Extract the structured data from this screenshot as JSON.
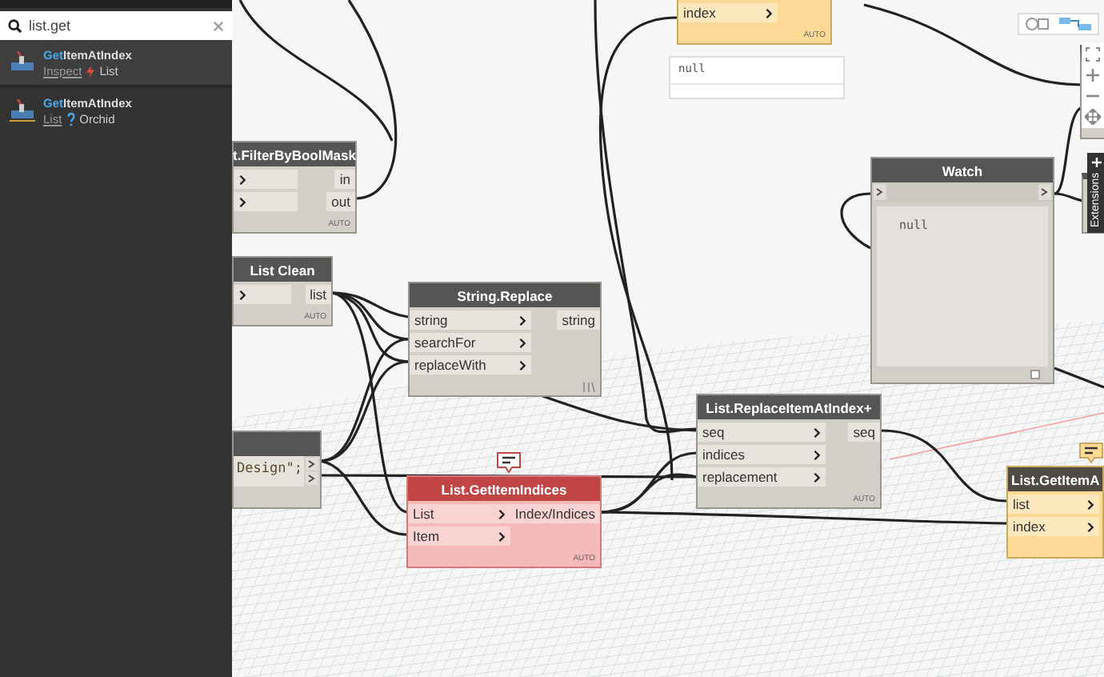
{
  "library": {
    "search": {
      "value": "list.get"
    },
    "results": [
      {
        "match": "Get",
        "rest": "ItemAtIndex",
        "category": "Inspect",
        "kind": "action",
        "package": "List",
        "selected": true
      },
      {
        "match": "Get",
        "rest": "ItemAtIndex",
        "category": "List",
        "kind": "query",
        "package": "Orchid",
        "selected": false
      }
    ]
  },
  "nodes": [
    {
      "kind": "node",
      "title": "t.FilterByBoolMask",
      "error": false,
      "warning": false,
      "inputs": [
        {
          "kind": "bare"
        },
        {
          "kind": "bare"
        }
      ],
      "outputs": [
        {
          "label": "in"
        },
        {
          "label": "out"
        }
      ],
      "lacing": {
        "kind": "text",
        "label": "AUTO"
      }
    },
    {
      "kind": "node",
      "title": "List Clean",
      "error": false,
      "warning": false,
      "inputs": [
        {
          "kind": "bare"
        }
      ],
      "outputs": [
        {
          "label": "list"
        }
      ],
      "lacing": {
        "kind": "text",
        "label": "AUTO"
      }
    },
    {
      "kind": "node",
      "title": "String.Replace",
      "error": false,
      "warning": false,
      "inputs": [
        {
          "kind": "labeled",
          "label": "string"
        },
        {
          "kind": "labeled",
          "label": "searchFor"
        },
        {
          "kind": "labeled",
          "label": "replaceWith"
        }
      ],
      "outputs": [
        {
          "label": "string"
        }
      ],
      "lacing": {
        "kind": "icon"
      }
    },
    {
      "kind": "code",
      "code": "Design\";",
      "outputs": [
        {
          "kind": "bare"
        },
        {
          "kind": "bare"
        }
      ]
    },
    {
      "kind": "node",
      "title": "List.GetItemIndices",
      "error": true,
      "warning": false,
      "info_bubble": true,
      "inputs": [
        {
          "kind": "labeled",
          "label": "List"
        },
        {
          "kind": "labeled",
          "label": "Item"
        }
      ],
      "outputs": [
        {
          "label": "Index/Indices"
        }
      ],
      "lacing": {
        "kind": "text",
        "label": "AUTO"
      }
    },
    {
      "kind": "node",
      "title": "List.ReplaceItemAtIndex+",
      "error": false,
      "warning": false,
      "inputs": [
        {
          "kind": "labeled",
          "label": "seq"
        },
        {
          "kind": "labeled",
          "label": "indices"
        },
        {
          "kind": "labeled",
          "label": "replacement"
        }
      ],
      "outputs": [
        {
          "label": "seq"
        }
      ],
      "lacing": {
        "kind": "text",
        "label": "AUTO"
      }
    },
    {
      "kind": "watch",
      "title": "Watch",
      "value": "null"
    },
    {
      "kind": "node",
      "error": false,
      "warning": true,
      "inputs": [
        {
          "kind": "labeled",
          "label": "index"
        }
      ],
      "lacing": {
        "kind": "text",
        "label": "AUTO"
      },
      "preview": "null"
    },
    {
      "kind": "node",
      "title": "List.GetItemA",
      "error": false,
      "warning": true,
      "info_bubble": true,
      "inputs": [
        {
          "kind": "labeled",
          "label": "list"
        },
        {
          "kind": "labeled",
          "label": "index"
        }
      ]
    }
  ],
  "extensions_tab": {
    "label": "Extensions"
  }
}
